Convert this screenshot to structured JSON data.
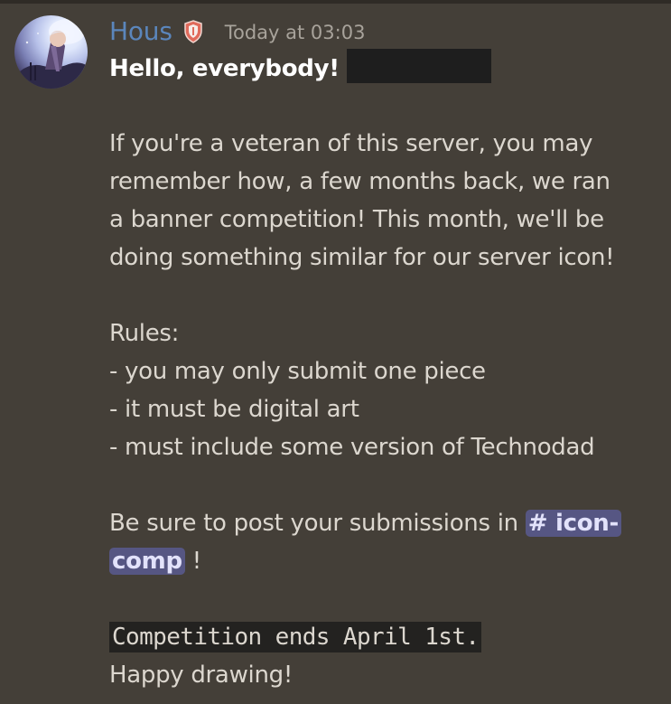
{
  "message": {
    "author": "Hous",
    "timestamp": "Today at 03:03",
    "badge_icon": "shield-badge-icon",
    "greeting": "Hello, everybody!",
    "paragraph1": [
      "If you're a veteran of this server, you may",
      "remember how, a few months back, we ran",
      "a banner competition! This month, we'll be",
      "doing something similar for our server icon!"
    ],
    "rules_heading": "Rules:",
    "rules": [
      "- you may only submit one piece",
      "- it must be digital art",
      "- must include some version of Technodad"
    ],
    "submission_prefix": "Be sure to post your submissions in",
    "channel_mention_line1": "# icon-",
    "channel_mention_line2": "comp",
    "submission_suffix": " !",
    "deadline_code": "Competition ends April 1st.",
    "closing": "Happy drawing!"
  },
  "colors": {
    "background": "#443f38",
    "username": "#5b86bc",
    "text": "#dcd7cf",
    "mention_bg": "#565683",
    "code_bg": "#232220",
    "redaction": "#1e1e1e"
  }
}
